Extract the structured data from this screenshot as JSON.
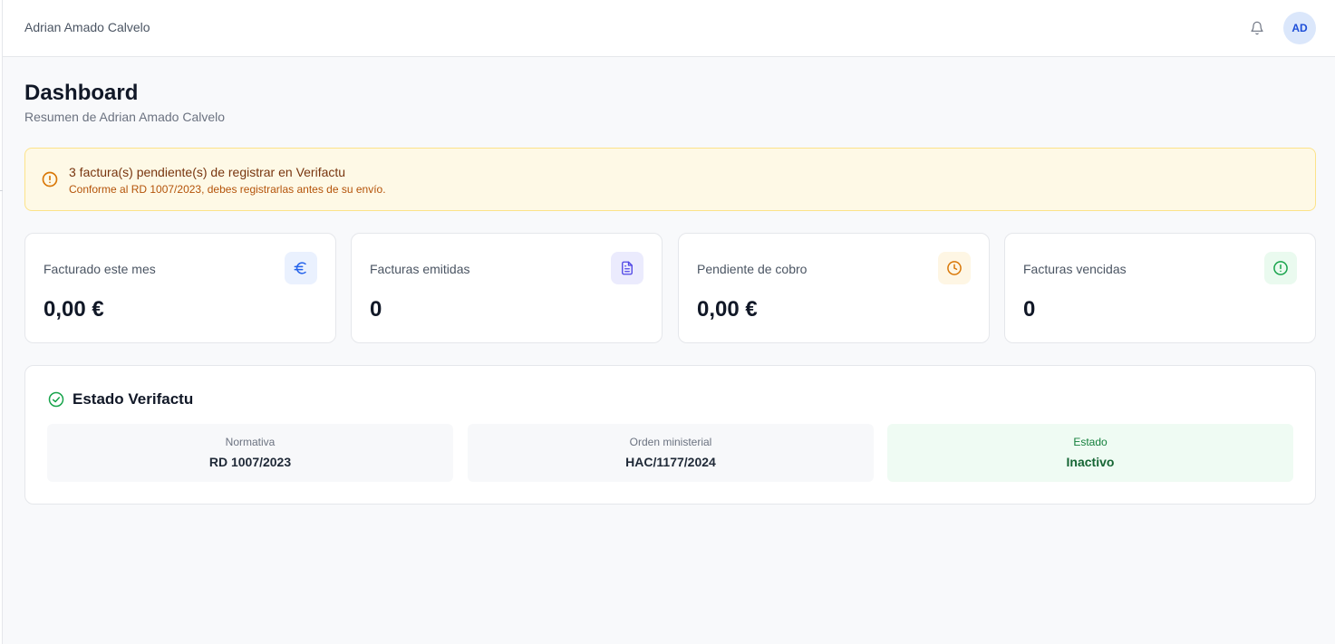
{
  "header": {
    "user_name": "Adrian Amado Calvelo",
    "avatar_initials": "AD",
    "notification_icon": "bell-icon"
  },
  "page": {
    "title": "Dashboard",
    "subtitle": "Resumen de Adrian Amado Calvelo"
  },
  "alert": {
    "icon": "alert-circle-icon",
    "title": "3 factura(s) pendiente(s) de registrar en Verifactu",
    "description": "Conforme al RD 1007/2023, debes registrarlas antes de su envío.",
    "colors": {
      "background": "#fef9e6",
      "border": "#fce38a",
      "text": "#78350f",
      "accent": "#d97706"
    }
  },
  "stats_cards": [
    {
      "label": "Facturado este mes",
      "value": "0,00 €",
      "icon": "euro-icon",
      "icon_color": "#2563eb",
      "icon_bg": "#eaf1fe"
    },
    {
      "label": "Facturas emitidas",
      "value": "0",
      "icon": "document-icon",
      "icon_color": "#4f46e5",
      "icon_bg": "#ebebfd"
    },
    {
      "label": "Pendiente de cobro",
      "value": "0,00 €",
      "icon": "clock-icon",
      "icon_color": "#d97706",
      "icon_bg": "#fef6e4"
    },
    {
      "label": "Facturas vencidas",
      "value": "0",
      "icon": "alert-circle-icon",
      "icon_color": "#16a34a",
      "icon_bg": "#eafaef"
    }
  ],
  "verifactu": {
    "icon": "check-circle-icon",
    "title": "Estado Verifactu",
    "items": [
      {
        "label": "Normativa",
        "value": "RD 1007/2023"
      },
      {
        "label": "Orden ministerial",
        "value": "HAC/1177/2024"
      },
      {
        "label": "Estado",
        "value": "Inactivo",
        "status_color": "#166534"
      }
    ]
  }
}
